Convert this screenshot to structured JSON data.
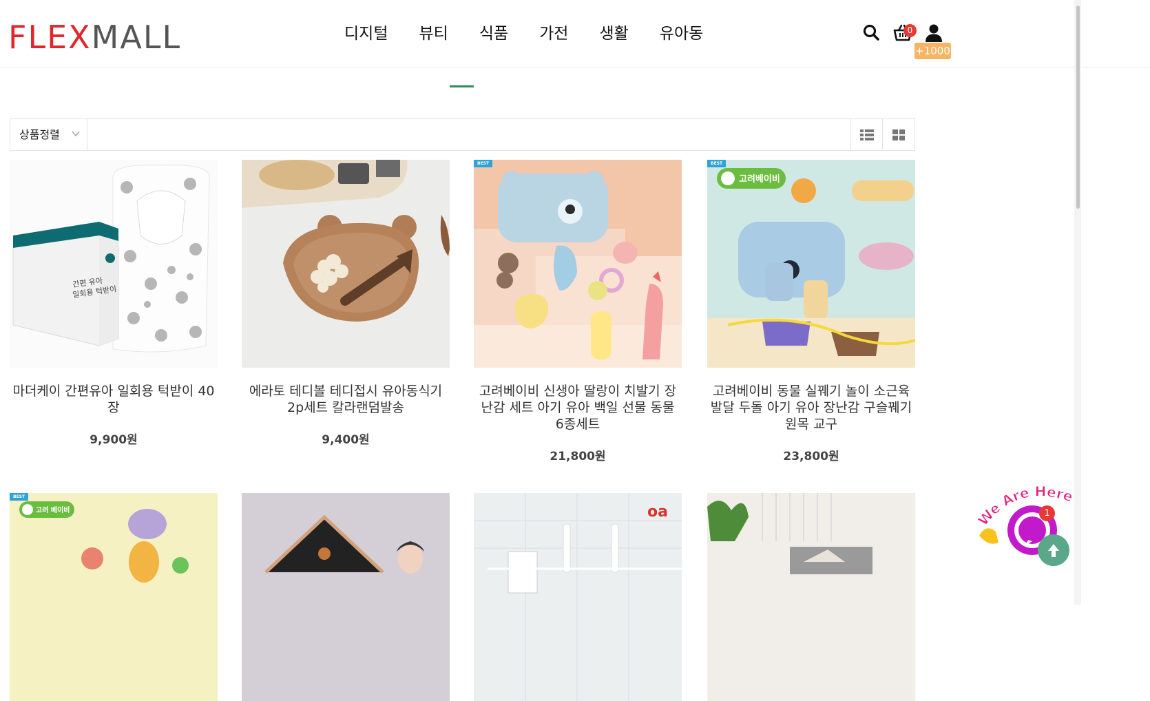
{
  "header": {
    "logo_part1": "FLEX",
    "logo_part2": "MALL",
    "nav": [
      "디지털",
      "뷰티",
      "식품",
      "가전",
      "생활",
      "유아동"
    ],
    "cart_count": "0",
    "points": "+1000"
  },
  "toolbar": {
    "sort_label": "상품정렬"
  },
  "products": [
    {
      "title": "마더케이 간편유아 일회용 턱받이 40장",
      "price": "9,900원",
      "best": ""
    },
    {
      "title": "에라토 테디볼 테디접시 유아동식기 2p세트 칼라랜덤발송",
      "price": "9,400원",
      "best": ""
    },
    {
      "title": "고려베이비 신생아 딸랑이 치발기 장난감 세트 아기 유아 백일 선물 동물 6종세트",
      "price": "21,800원",
      "best": "BEST"
    },
    {
      "title": "고려베이비 동물 실꿰기 놀이 소근육 발달 두돌 아기 유아 장난감 구슬꿰기 원목 교구",
      "price": "23,800원",
      "best": "BEST"
    }
  ],
  "products_row2": [
    {
      "best": "BEST",
      "brand_tag": "고려 베이비"
    },
    {
      "best": "",
      "brand_tag": ""
    },
    {
      "best": "",
      "brand_tag": ""
    },
    {
      "best": "",
      "brand_tag": ""
    }
  ],
  "chat": {
    "badge": "1",
    "bubble_text": "We Are Here!"
  },
  "colors": {
    "logo_red": "#e0262b",
    "accent_green": "#2e8b57",
    "points_orange": "#f6b564",
    "chat_purple": "#c21acb",
    "top_button": "#5aa78a"
  }
}
